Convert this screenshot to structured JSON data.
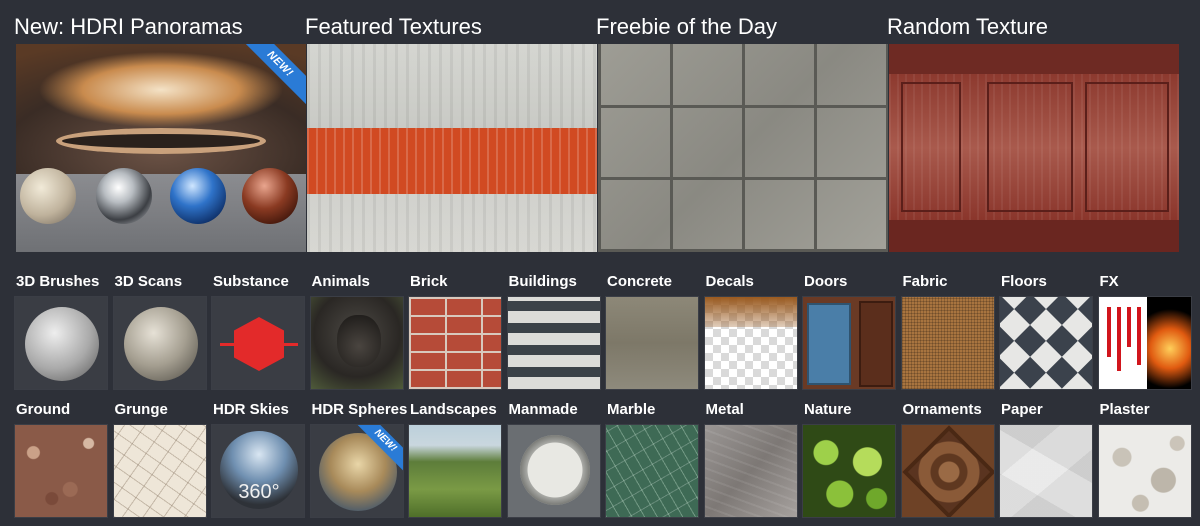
{
  "featured": [
    {
      "title": "New: HDRI Panoramas",
      "badge": "NEW!"
    },
    {
      "title": "Featured Textures"
    },
    {
      "title": "Freebie of the Day"
    },
    {
      "title": "Random Texture"
    }
  ],
  "categories": [
    {
      "label": "3D Brushes"
    },
    {
      "label": "3D Scans"
    },
    {
      "label": "Substance"
    },
    {
      "label": "Animals"
    },
    {
      "label": "Brick"
    },
    {
      "label": "Buildings"
    },
    {
      "label": "Concrete"
    },
    {
      "label": "Decals"
    },
    {
      "label": "Doors"
    },
    {
      "label": "Fabric"
    },
    {
      "label": "Floors"
    },
    {
      "label": "FX"
    },
    {
      "label": "Ground"
    },
    {
      "label": "Grunge"
    },
    {
      "label": "HDR Skies",
      "thumb_text": "360°"
    },
    {
      "label": "HDR Spheres",
      "badge": "NEW!"
    },
    {
      "label": "Landscapes"
    },
    {
      "label": "Manmade"
    },
    {
      "label": "Marble"
    },
    {
      "label": "Metal"
    },
    {
      "label": "Nature"
    },
    {
      "label": "Ornaments"
    },
    {
      "label": "Paper"
    },
    {
      "label": "Plaster"
    }
  ],
  "colors": {
    "background": "#2d3038",
    "text": "#ffffff",
    "ribbon": "#2a7bd6"
  }
}
